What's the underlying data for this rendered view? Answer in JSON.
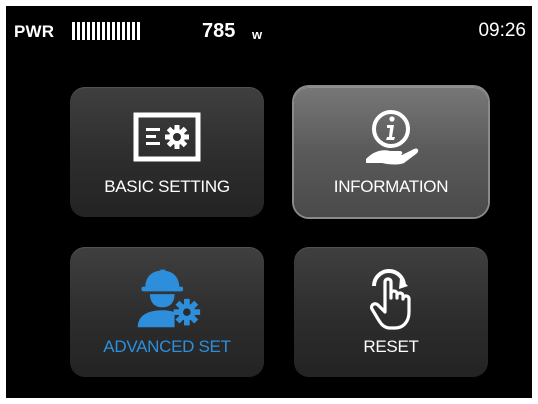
{
  "status_bar": {
    "power_label": "PWR",
    "power_level": 0.7,
    "power_value": "785",
    "power_unit": "w",
    "time": "09:26"
  },
  "menu": {
    "tiles": [
      {
        "label": "BASIC SETTING",
        "icon": "settings-card-icon"
      },
      {
        "label": "INFORMATION",
        "icon": "info-hand-icon",
        "selected": true
      },
      {
        "label": "ADVANCED SET",
        "icon": "engineer-gear-icon",
        "accent_color": "#2d8fdc"
      },
      {
        "label": "RESET",
        "icon": "touch-rotate-icon"
      }
    ]
  }
}
